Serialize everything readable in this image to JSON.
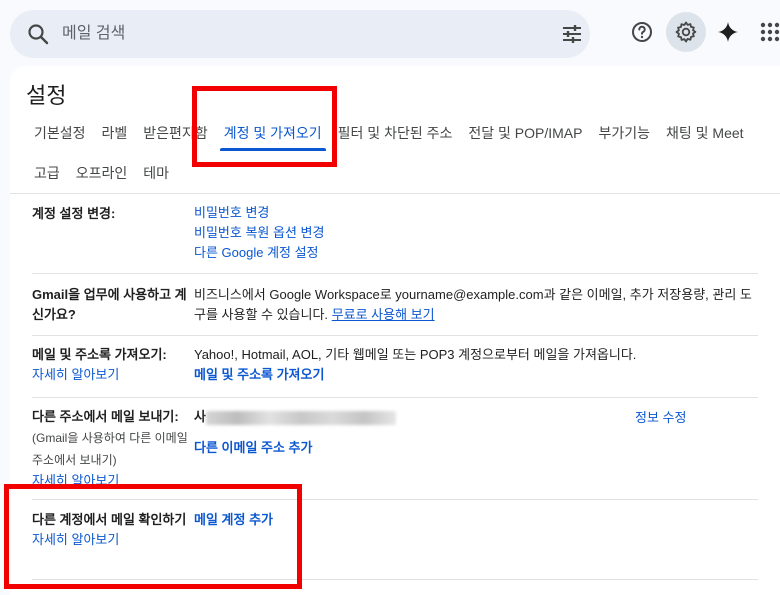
{
  "search": {
    "placeholder": "메일 검색"
  },
  "page_title": "설정",
  "tabs_row1": [
    "기본설정",
    "라벨",
    "받은편지함",
    "계정 및 가져오기",
    "필터 및 차단된 주소",
    "전달 및 POP/IMAP",
    "부가기능",
    "채팅 및 Meet"
  ],
  "tabs_row2": [
    "고급",
    "오프라인",
    "테마"
  ],
  "active_tab": "계정 및 가져오기",
  "rows": {
    "change_account": {
      "label": "계정 설정 변경:",
      "links": [
        "비밀번호 변경",
        "비밀번호 복원 옵션 변경",
        "다른 Google 계정 설정"
      ]
    },
    "workspace": {
      "label": "Gmail을 업무에 사용하고 계신가요?",
      "text": "비즈니스에서 Google Workspace로 yourname@example.com과 같은 이메일, 추가 저장용량, 관리 도구를 사용할 수 있습니다.",
      "link": "무료로 사용해 보기"
    },
    "import": {
      "label": "메일 및 주소록 가져오기:",
      "learn_more": "자세히 알아보기",
      "text": "Yahoo!, Hotmail, AOL, 기타 웹메일 또는 POP3 계정으로부터 메일을 가져옵니다.",
      "action": "메일 및 주소록 가져오기"
    },
    "send_as": {
      "label": "다른 주소에서 메일 보내기:",
      "sub": "(Gmail을 사용하여 다른 이메일 주소에서 보내기)",
      "learn_more": "자세히 알아보기",
      "name_prefix": "사",
      "edit": "정보 수정",
      "action": "다른 이메일 주소 추가"
    },
    "check_mail": {
      "label": "다른 계정에서 메일 확인하기",
      "learn_more": "자세히 알아보기",
      "action": "메일 계정 추가"
    }
  },
  "colors": {
    "accent": "#0b57d0",
    "highlight": "#f20000",
    "background": "#f8fafd"
  }
}
